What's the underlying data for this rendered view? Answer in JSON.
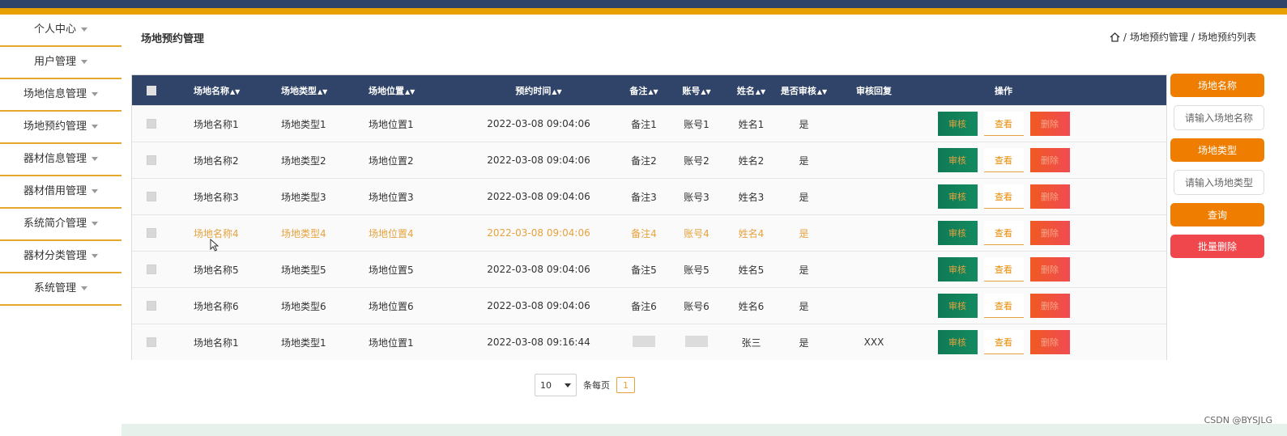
{
  "sidebar": {
    "items": [
      {
        "label": "个人中心"
      },
      {
        "label": "用户管理"
      },
      {
        "label": "场地信息管理"
      },
      {
        "label": "场地预约管理"
      },
      {
        "label": "器材信息管理"
      },
      {
        "label": "器材借用管理"
      },
      {
        "label": "系统简介管理"
      },
      {
        "label": "器材分类管理"
      },
      {
        "label": "系统管理"
      }
    ]
  },
  "header": {
    "title": "场地预约管理",
    "breadcrumb": {
      "sep1": "/",
      "level1": "场地预约管理",
      "sep2": "/",
      "level2": "场地预约列表"
    }
  },
  "table": {
    "columns": {
      "name": "场地名称",
      "type": "场地类型",
      "position": "场地位置",
      "time": "预约时间",
      "note": "备注",
      "account": "账号",
      "username": "姓名",
      "audited": "是否审核",
      "reply": "审核回复",
      "ops": "操作"
    },
    "actions": {
      "audit": "审核",
      "view": "查看",
      "delete": "删除"
    },
    "rows": [
      {
        "name": "场地名称1",
        "type": "场地类型1",
        "position": "场地位置1",
        "time": "2022-03-08 09:04:06",
        "note": "备注1",
        "account": "账号1",
        "username": "姓名1",
        "audited": "是",
        "reply": ""
      },
      {
        "name": "场地名称2",
        "type": "场地类型2",
        "position": "场地位置2",
        "time": "2022-03-08 09:04:06",
        "note": "备注2",
        "account": "账号2",
        "username": "姓名2",
        "audited": "是",
        "reply": ""
      },
      {
        "name": "场地名称3",
        "type": "场地类型3",
        "position": "场地位置3",
        "time": "2022-03-08 09:04:06",
        "note": "备注3",
        "account": "账号3",
        "username": "姓名3",
        "audited": "是",
        "reply": ""
      },
      {
        "name": "场地名称4",
        "type": "场地类型4",
        "position": "场地位置4",
        "time": "2022-03-08 09:04:06",
        "note": "备注4",
        "account": "账号4",
        "username": "姓名4",
        "audited": "是",
        "reply": ""
      },
      {
        "name": "场地名称5",
        "type": "场地类型5",
        "position": "场地位置5",
        "time": "2022-03-08 09:04:06",
        "note": "备注5",
        "account": "账号5",
        "username": "姓名5",
        "audited": "是",
        "reply": ""
      },
      {
        "name": "场地名称6",
        "type": "场地类型6",
        "position": "场地位置6",
        "time": "2022-03-08 09:04:06",
        "note": "备注6",
        "account": "账号6",
        "username": "姓名6",
        "audited": "是",
        "reply": ""
      },
      {
        "name": "场地名称1",
        "type": "场地类型1",
        "position": "场地位置1",
        "time": "2022-03-08 09:16:44",
        "note": "",
        "account": "",
        "username": "张三",
        "audited": "是",
        "reply": "XXX"
      }
    ]
  },
  "pagination": {
    "page_size": "10",
    "per_page_label": "条每页",
    "current_page": "1"
  },
  "search": {
    "name_button": "场地名称",
    "name_placeholder": "请输入场地名称",
    "type_button": "场地类型",
    "type_placeholder": "请输入场地类型",
    "query_button": "查询",
    "batch_delete_button": "批量删除"
  },
  "watermark": "CSDN @BYSJLG",
  "colors": {
    "navy": "#2f4468",
    "gold": "#e8a000",
    "orange": "#ef7d00",
    "red": "#f0474c",
    "green": "#0f7a55"
  }
}
